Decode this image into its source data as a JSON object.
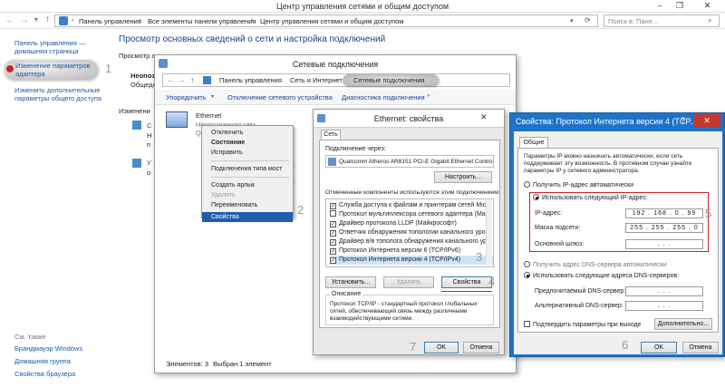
{
  "window": {
    "title": "Центр управления сетями и общим доступом",
    "min": "–",
    "max": "❐",
    "close": "✕"
  },
  "address": {
    "crumbs": [
      "Панель управления",
      "Все элементы панели управления",
      "Центр управления сетями и общим доступом"
    ],
    "search_placeholder": "Поиск в: Пане..."
  },
  "sidebar": {
    "home": "Панель управления — домашняя страница",
    "adapter": "Изменение параметров адаптера",
    "sharing": "Изменить дополнительные параметры общего доступа",
    "see_also": "См. также",
    "links": [
      "Брандмауэр Windows",
      "Домашняя группа",
      "Свойства браузера"
    ]
  },
  "main": {
    "heading": "Просмотр основных сведений о сети и настройка подключений",
    "view": "Просмотр а",
    "unknown1": "Неопоз",
    "unknown2": "Общедо",
    "change": "Изменени",
    "frag1": "С",
    "frag2": "Н",
    "frag3": "п",
    "frag4": "Н",
    "frag5": "н",
    "frag6": "У",
    "frag7": "о"
  },
  "netconn": {
    "title": "Сетевые подключения",
    "crumbs": [
      "Панель управления",
      "Сеть и Интернет",
      "Сетевые подключения"
    ],
    "toolbar": [
      "Упорядочить",
      "Отключение сетевого устройства",
      "Диагностика подключения"
    ],
    "adapter_name": "Ethernet",
    "adapter_status": "Неопознанная сеть",
    "adapter_frag": "Qua",
    "status_items": "Элементов: 3",
    "status_sel": "Выбран 1 элемент"
  },
  "context": {
    "items": [
      "Отключить",
      "Состояние",
      "Исправить",
      "Подключения типа мост",
      "Создать ярлык",
      "Удалить",
      "Переименовать",
      "Свойства"
    ]
  },
  "ethprops": {
    "title": "Ethernet: свойства",
    "tab": "Сеть",
    "connect_via": "Подключение через:",
    "adapter": "Qualcomm Atheros AR8151 PCI-E Gigabit Ethernet Contro",
    "configure": "Настроить...",
    "components_label": "Отмеченные компоненты используются этим подключением:",
    "components": [
      "Служба доступа к файлам и принтерам сетей Micro",
      "Протокол мультиплексора сетевого адаптера (Ma",
      "Драйвер протокола LLDP (Майкрософт)",
      "Ответчик обнаружения топологии канального уров",
      "Драйвер в/в тополога обнаружения канального ур",
      "Протокол Интернета версии 6 (TCP/IPv6)",
      "Протокол Интернета версии 4 (TCP/IPv4)"
    ],
    "install": "Установить...",
    "remove": "Удалить",
    "props": "Свойства",
    "desc_label": "Описание",
    "desc": "Протокол TCP/IP - стандартный протокол глобальных сетей, обеспечивающий связь между различными взаимодействующими сетями.",
    "ok": "OK",
    "cancel": "Отмена"
  },
  "ipv4": {
    "title": "Свойства: Протокол Интернета версии 4 (TCP...",
    "help": "?",
    "tab": "Общие",
    "info": "Параметры IP можно назначать автоматически, если сеть поддерживает эту возможность. В противном случае узнайте параметры IP у сетевого администратора.",
    "auto_ip": "Получить IP-адрес автоматически",
    "use_ip": "Использовать следующий IP-адрес:",
    "ip_label": "IP-адрес:",
    "ip_value": "192 . 168 .  0  . 99",
    "mask_label": "Маска подсети:",
    "mask_value": "255 . 255 . 255 .  0",
    "gw_label": "Основной шлюз:",
    "gw_value": " .    .    . ",
    "auto_dns": "Получить адрес DNS-сервера автоматически",
    "use_dns": "Использовать следующие адреса DNS-серверов:",
    "dns1_label": "Предпочитаемый DNS-сервер:",
    "dns2_label": "Альтернативный DNS-сервер:",
    "dns_value": " .    .    . ",
    "validate": "Подтвердить параметры при выходе",
    "advanced": "Дополнительно...",
    "ok": "OK",
    "cancel": "Отмена"
  },
  "steps": [
    "1",
    "2",
    "3",
    "4",
    "5",
    "6",
    "7"
  ],
  "colors": {
    "highlight": "#cc2222",
    "link": "#1a5aa6",
    "dialog_blue": "#1e73c8"
  }
}
